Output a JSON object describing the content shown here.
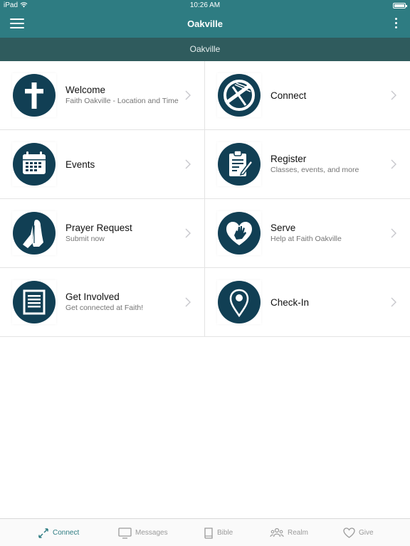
{
  "status": {
    "carrier": "iPad",
    "time": "10:26 AM"
  },
  "header": {
    "title": "Oakville",
    "location_label": "Oakville"
  },
  "tiles": [
    {
      "title": "Welcome",
      "subtitle": "Faith Oakville - Location and Time",
      "icon": "cross-icon"
    },
    {
      "title": "Connect",
      "subtitle": "",
      "icon": "connect-logo-icon"
    },
    {
      "title": "Events",
      "subtitle": "",
      "icon": "calendar-icon"
    },
    {
      "title": "Register",
      "subtitle": "Classes, events, and more",
      "icon": "clipboard-icon"
    },
    {
      "title": "Prayer Request",
      "subtitle": "Submit now",
      "icon": "praying-hands-icon"
    },
    {
      "title": "Serve",
      "subtitle": "Help at Faith Oakville",
      "icon": "heart-hand-icon"
    },
    {
      "title": "Get Involved",
      "subtitle": "Get connected at Faith!",
      "icon": "document-icon"
    },
    {
      "title": "Check-In",
      "subtitle": "",
      "icon": "map-pin-icon"
    }
  ],
  "tabs": [
    {
      "label": "Connect",
      "icon": "connect-arrows-icon",
      "active": true
    },
    {
      "label": "Messages",
      "icon": "monitor-icon",
      "active": false
    },
    {
      "label": "Bible",
      "icon": "book-icon",
      "active": false
    },
    {
      "label": "Realm",
      "icon": "people-icon",
      "active": false
    },
    {
      "label": "Give",
      "icon": "heart-icon",
      "active": false
    }
  ],
  "colors": {
    "header": "#2e7c82",
    "subheader": "#2f5b5d",
    "icon_circle": "#113f54",
    "active_tab": "#2e7c82"
  }
}
